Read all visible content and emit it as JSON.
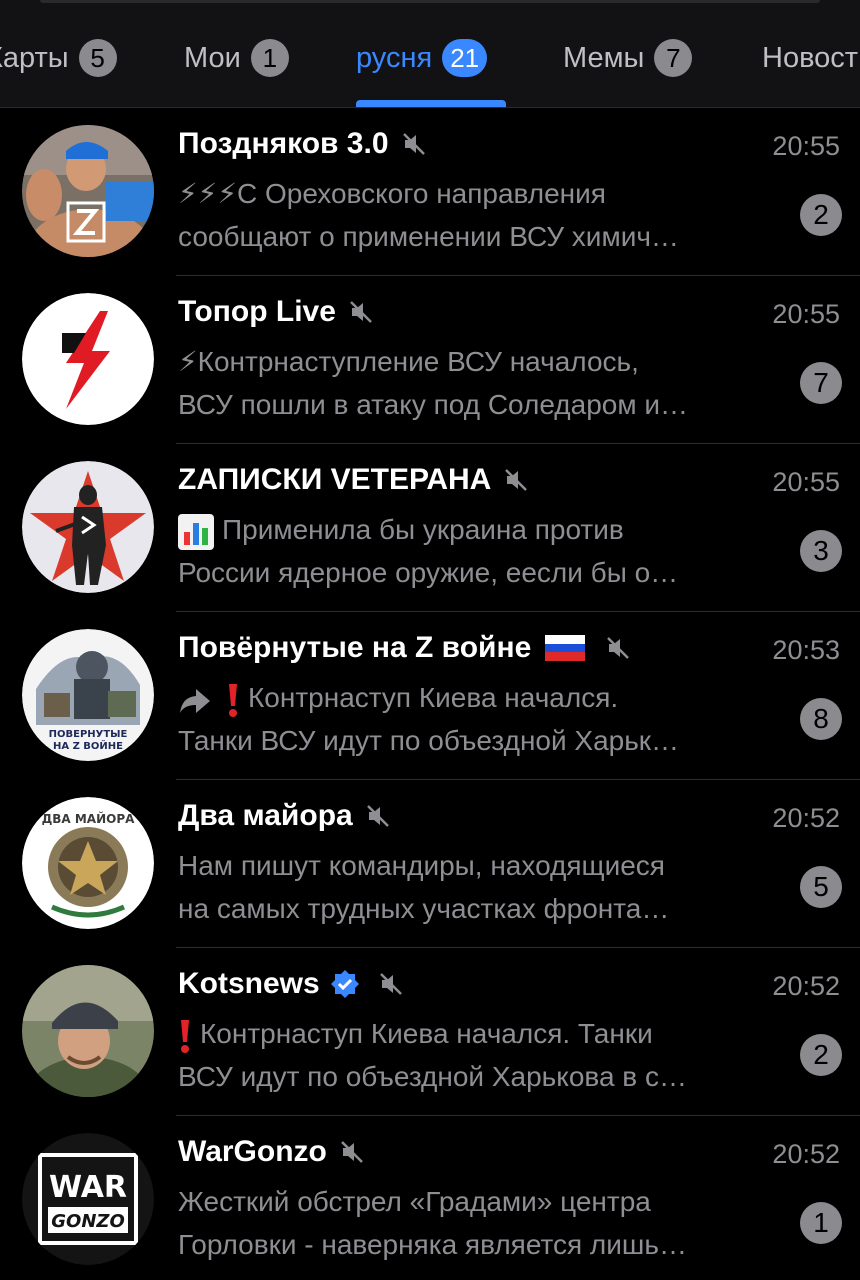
{
  "tabs": [
    {
      "label": "Карты",
      "count": "5"
    },
    {
      "label": "Мои",
      "count": "1"
    },
    {
      "label": "русня",
      "count": "21"
    },
    {
      "label": "Мемы",
      "count": "7"
    },
    {
      "label": "Новости",
      "count": ""
    }
  ],
  "active_tab": "русня",
  "colors": {
    "accent": "#3a88ff",
    "background": "#000000",
    "secondary_text": "#8e8e93",
    "badge": "#8a8a8f"
  },
  "chats": [
    {
      "title": "Поздняков 3.0",
      "time": "20:55",
      "unread": "2",
      "line1": "⚡⚡⚡С Ореховского направления",
      "line2": "сообщают о применении ВСУ химич…",
      "muted": true,
      "avatar_icon": "bodybuilder-photo-avatar"
    },
    {
      "title": "Топор Live",
      "time": "20:55",
      "unread": "7",
      "line1": "⚡Контрнаступление ВСУ началось,",
      "line2": "ВСУ пошли в атаку под Соледаром и…",
      "muted": true,
      "avatar_icon": "axe-lightning-logo-avatar"
    },
    {
      "title": "ZАПИСКИ VЕТЕРАНА",
      "time": "20:55",
      "unread": "3",
      "line1": "Применила бы украина против",
      "line2": "России ядерное оружие, еесли бы о…",
      "muted": true,
      "avatar_icon": "soldier-star-avatar"
    },
    {
      "title": "Повёрнутые на Z войне",
      "time": "20:53",
      "unread": "8",
      "line1": "Контрнаступ Киева начался.",
      "line2": "Танки ВСУ идут по объездной Харьк…",
      "muted": true,
      "avatar_icon": "soldiers-collage-avatar",
      "avatar_text": [
        "ПОВЕРНУТЫЕ",
        "НА Z ВОЙНЕ"
      ]
    },
    {
      "title": "Два майора",
      "time": "20:52",
      "unread": "5",
      "line1": "Нам пишут командиры, находящиеся",
      "line2": "на самых трудных участках фронта…",
      "muted": true,
      "avatar_icon": "two-majors-emblem-avatar",
      "avatar_text": [
        "ДВА МАЙОРА"
      ]
    },
    {
      "title": "Kotsnews",
      "time": "20:52",
      "unread": "2",
      "line1": "Контрнаступ Киева начался. Танки",
      "line2": "ВСУ идут по объездной Харькова в с…",
      "muted": true,
      "avatar_icon": "helmet-man-photo-avatar"
    },
    {
      "title": "WarGonzo",
      "time": "20:52",
      "unread": "1",
      "line1": "Жесткий обстрел «Градами» центра",
      "line2": "Горловки - наверняка является лишь…",
      "muted": true,
      "avatar_icon": "wargonzo-logo-avatar",
      "avatar_text": [
        "WAR",
        "GONZO"
      ]
    }
  ]
}
